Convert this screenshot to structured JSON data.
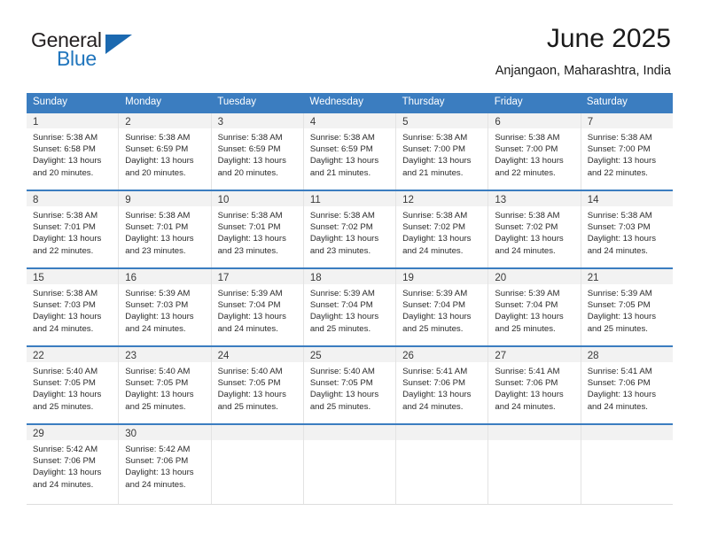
{
  "brand": {
    "name_top": "General",
    "name_bottom": "Blue",
    "accent_color": "#1b69b0",
    "text_color": "#231f20"
  },
  "header": {
    "title": "June 2025",
    "subtitle": "Anjangaon, Maharashtra, India"
  },
  "calendar": {
    "header_bg": "#3b7dc0",
    "weekdays": [
      "Sunday",
      "Monday",
      "Tuesday",
      "Wednesday",
      "Thursday",
      "Friday",
      "Saturday"
    ],
    "labels": {
      "sunrise": "Sunrise:",
      "sunset": "Sunset:",
      "daylight": "Daylight:"
    },
    "weeks": [
      [
        {
          "day": "1",
          "sunrise": "Sunrise: 5:38 AM",
          "sunset": "Sunset: 6:58 PM",
          "daylight_line1": "Daylight: 13 hours",
          "daylight_line2": "and 20 minutes."
        },
        {
          "day": "2",
          "sunrise": "Sunrise: 5:38 AM",
          "sunset": "Sunset: 6:59 PM",
          "daylight_line1": "Daylight: 13 hours",
          "daylight_line2": "and 20 minutes."
        },
        {
          "day": "3",
          "sunrise": "Sunrise: 5:38 AM",
          "sunset": "Sunset: 6:59 PM",
          "daylight_line1": "Daylight: 13 hours",
          "daylight_line2": "and 20 minutes."
        },
        {
          "day": "4",
          "sunrise": "Sunrise: 5:38 AM",
          "sunset": "Sunset: 6:59 PM",
          "daylight_line1": "Daylight: 13 hours",
          "daylight_line2": "and 21 minutes."
        },
        {
          "day": "5",
          "sunrise": "Sunrise: 5:38 AM",
          "sunset": "Sunset: 7:00 PM",
          "daylight_line1": "Daylight: 13 hours",
          "daylight_line2": "and 21 minutes."
        },
        {
          "day": "6",
          "sunrise": "Sunrise: 5:38 AM",
          "sunset": "Sunset: 7:00 PM",
          "daylight_line1": "Daylight: 13 hours",
          "daylight_line2": "and 22 minutes."
        },
        {
          "day": "7",
          "sunrise": "Sunrise: 5:38 AM",
          "sunset": "Sunset: 7:00 PM",
          "daylight_line1": "Daylight: 13 hours",
          "daylight_line2": "and 22 minutes."
        }
      ],
      [
        {
          "day": "8",
          "sunrise": "Sunrise: 5:38 AM",
          "sunset": "Sunset: 7:01 PM",
          "daylight_line1": "Daylight: 13 hours",
          "daylight_line2": "and 22 minutes."
        },
        {
          "day": "9",
          "sunrise": "Sunrise: 5:38 AM",
          "sunset": "Sunset: 7:01 PM",
          "daylight_line1": "Daylight: 13 hours",
          "daylight_line2": "and 23 minutes."
        },
        {
          "day": "10",
          "sunrise": "Sunrise: 5:38 AM",
          "sunset": "Sunset: 7:01 PM",
          "daylight_line1": "Daylight: 13 hours",
          "daylight_line2": "and 23 minutes."
        },
        {
          "day": "11",
          "sunrise": "Sunrise: 5:38 AM",
          "sunset": "Sunset: 7:02 PM",
          "daylight_line1": "Daylight: 13 hours",
          "daylight_line2": "and 23 minutes."
        },
        {
          "day": "12",
          "sunrise": "Sunrise: 5:38 AM",
          "sunset": "Sunset: 7:02 PM",
          "daylight_line1": "Daylight: 13 hours",
          "daylight_line2": "and 24 minutes."
        },
        {
          "day": "13",
          "sunrise": "Sunrise: 5:38 AM",
          "sunset": "Sunset: 7:02 PM",
          "daylight_line1": "Daylight: 13 hours",
          "daylight_line2": "and 24 minutes."
        },
        {
          "day": "14",
          "sunrise": "Sunrise: 5:38 AM",
          "sunset": "Sunset: 7:03 PM",
          "daylight_line1": "Daylight: 13 hours",
          "daylight_line2": "and 24 minutes."
        }
      ],
      [
        {
          "day": "15",
          "sunrise": "Sunrise: 5:38 AM",
          "sunset": "Sunset: 7:03 PM",
          "daylight_line1": "Daylight: 13 hours",
          "daylight_line2": "and 24 minutes."
        },
        {
          "day": "16",
          "sunrise": "Sunrise: 5:39 AM",
          "sunset": "Sunset: 7:03 PM",
          "daylight_line1": "Daylight: 13 hours",
          "daylight_line2": "and 24 minutes."
        },
        {
          "day": "17",
          "sunrise": "Sunrise: 5:39 AM",
          "sunset": "Sunset: 7:04 PM",
          "daylight_line1": "Daylight: 13 hours",
          "daylight_line2": "and 24 minutes."
        },
        {
          "day": "18",
          "sunrise": "Sunrise: 5:39 AM",
          "sunset": "Sunset: 7:04 PM",
          "daylight_line1": "Daylight: 13 hours",
          "daylight_line2": "and 25 minutes."
        },
        {
          "day": "19",
          "sunrise": "Sunrise: 5:39 AM",
          "sunset": "Sunset: 7:04 PM",
          "daylight_line1": "Daylight: 13 hours",
          "daylight_line2": "and 25 minutes."
        },
        {
          "day": "20",
          "sunrise": "Sunrise: 5:39 AM",
          "sunset": "Sunset: 7:04 PM",
          "daylight_line1": "Daylight: 13 hours",
          "daylight_line2": "and 25 minutes."
        },
        {
          "day": "21",
          "sunrise": "Sunrise: 5:39 AM",
          "sunset": "Sunset: 7:05 PM",
          "daylight_line1": "Daylight: 13 hours",
          "daylight_line2": "and 25 minutes."
        }
      ],
      [
        {
          "day": "22",
          "sunrise": "Sunrise: 5:40 AM",
          "sunset": "Sunset: 7:05 PM",
          "daylight_line1": "Daylight: 13 hours",
          "daylight_line2": "and 25 minutes."
        },
        {
          "day": "23",
          "sunrise": "Sunrise: 5:40 AM",
          "sunset": "Sunset: 7:05 PM",
          "daylight_line1": "Daylight: 13 hours",
          "daylight_line2": "and 25 minutes."
        },
        {
          "day": "24",
          "sunrise": "Sunrise: 5:40 AM",
          "sunset": "Sunset: 7:05 PM",
          "daylight_line1": "Daylight: 13 hours",
          "daylight_line2": "and 25 minutes."
        },
        {
          "day": "25",
          "sunrise": "Sunrise: 5:40 AM",
          "sunset": "Sunset: 7:05 PM",
          "daylight_line1": "Daylight: 13 hours",
          "daylight_line2": "and 25 minutes."
        },
        {
          "day": "26",
          "sunrise": "Sunrise: 5:41 AM",
          "sunset": "Sunset: 7:06 PM",
          "daylight_line1": "Daylight: 13 hours",
          "daylight_line2": "and 24 minutes."
        },
        {
          "day": "27",
          "sunrise": "Sunrise: 5:41 AM",
          "sunset": "Sunset: 7:06 PM",
          "daylight_line1": "Daylight: 13 hours",
          "daylight_line2": "and 24 minutes."
        },
        {
          "day": "28",
          "sunrise": "Sunrise: 5:41 AM",
          "sunset": "Sunset: 7:06 PM",
          "daylight_line1": "Daylight: 13 hours",
          "daylight_line2": "and 24 minutes."
        }
      ],
      [
        {
          "day": "29",
          "sunrise": "Sunrise: 5:42 AM",
          "sunset": "Sunset: 7:06 PM",
          "daylight_line1": "Daylight: 13 hours",
          "daylight_line2": "and 24 minutes."
        },
        {
          "day": "30",
          "sunrise": "Sunrise: 5:42 AM",
          "sunset": "Sunset: 7:06 PM",
          "daylight_line1": "Daylight: 13 hours",
          "daylight_line2": "and 24 minutes."
        },
        {
          "day": "",
          "sunrise": "",
          "sunset": "",
          "daylight_line1": "",
          "daylight_line2": ""
        },
        {
          "day": "",
          "sunrise": "",
          "sunset": "",
          "daylight_line1": "",
          "daylight_line2": ""
        },
        {
          "day": "",
          "sunrise": "",
          "sunset": "",
          "daylight_line1": "",
          "daylight_line2": ""
        },
        {
          "day": "",
          "sunrise": "",
          "sunset": "",
          "daylight_line1": "",
          "daylight_line2": ""
        },
        {
          "day": "",
          "sunrise": "",
          "sunset": "",
          "daylight_line1": "",
          "daylight_line2": ""
        }
      ]
    ]
  }
}
